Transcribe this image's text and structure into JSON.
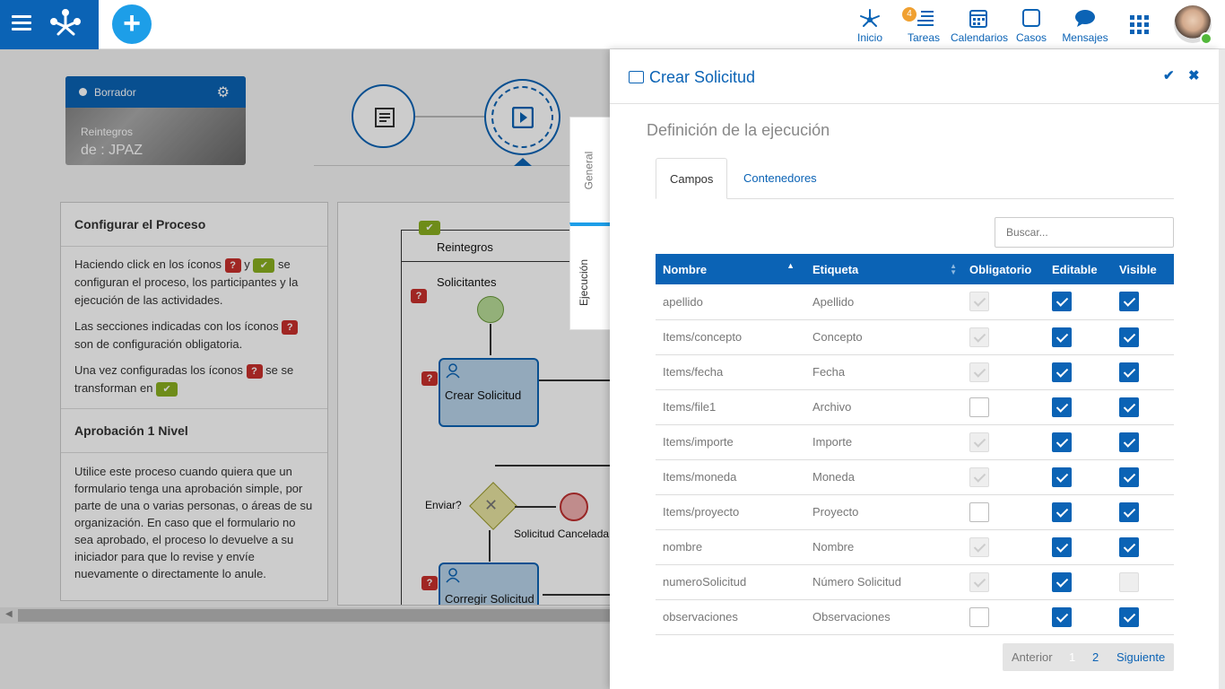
{
  "topbar": {
    "nav": [
      {
        "label": "Inicio",
        "icon": "network-icon"
      },
      {
        "label": "Tareas",
        "icon": "tasks-icon",
        "badge": "4"
      },
      {
        "label": "Calendarios",
        "icon": "calendar-icon"
      },
      {
        "label": "Casos",
        "icon": "square-icon"
      },
      {
        "label": "Mensajes",
        "icon": "chat-icon"
      }
    ]
  },
  "process_card": {
    "status": "Borrador",
    "title": "Reintegros",
    "owner": "de : JPAZ"
  },
  "left_panel": {
    "config_title": "Configurar el Proceso",
    "p1_a": "Haciendo click en los íconos",
    "p1_b": "y",
    "p1_c": "se configuran el proceso, los participantes y la ejecución de las actividades.",
    "p2_a": "Las secciones indicadas con los íconos",
    "p2_b": "son de configuración obligatoria.",
    "p3_a": "Una vez configuradas los íconos",
    "p3_b": "se transforman en",
    "approval_title": "Aprobación 1 Nivel",
    "approval_text": "Utilice este proceso cuando quiera que un formulario tenga una aprobación simple, por parte de una o varias personas, o áreas de su organización. En caso que el formulario no sea aprobado, el proceso lo devuelve a su iniciador para que lo revise y envíe nuevamente o directamente lo anule."
  },
  "diagram": {
    "pool": "Reintegros",
    "lane": "Solicitantes",
    "task1": "Crear Solicitud",
    "task2": "Corregir Solicitud",
    "gateway": "Enviar?",
    "end": "Solicitud Cancelada"
  },
  "vtabs": {
    "general": "General",
    "ejecucion": "Ejecución"
  },
  "side": {
    "title": "Crear Solicitud",
    "section": "Definición de la ejecución",
    "tabs": [
      "Campos",
      "Contenedores"
    ],
    "search_placeholder": "Buscar...",
    "columns": [
      "Nombre",
      "Etiqueta",
      "Obligatorio",
      "Editable",
      "Visible"
    ],
    "rows": [
      {
        "nombre": "apellido",
        "etiqueta": "Apellido",
        "obligatorio": "disabled-checked",
        "editable": true,
        "visible": true
      },
      {
        "nombre": "Items/concepto",
        "etiqueta": "Concepto",
        "obligatorio": "disabled-checked",
        "editable": true,
        "visible": true
      },
      {
        "nombre": "Items/fecha",
        "etiqueta": "Fecha",
        "obligatorio": "disabled-checked",
        "editable": true,
        "visible": true
      },
      {
        "nombre": "Items/file1",
        "etiqueta": "Archivo",
        "obligatorio": "unchecked",
        "editable": true,
        "visible": true
      },
      {
        "nombre": "Items/importe",
        "etiqueta": "Importe",
        "obligatorio": "disabled-checked",
        "editable": true,
        "visible": true
      },
      {
        "nombre": "Items/moneda",
        "etiqueta": "Moneda",
        "obligatorio": "disabled-checked",
        "editable": true,
        "visible": true
      },
      {
        "nombre": "Items/proyecto",
        "etiqueta": "Proyecto",
        "obligatorio": "unchecked",
        "editable": true,
        "visible": true
      },
      {
        "nombre": "nombre",
        "etiqueta": "Nombre",
        "obligatorio": "disabled-checked",
        "editable": true,
        "visible": true
      },
      {
        "nombre": "numeroSolicitud",
        "etiqueta": "Número Solicitud",
        "obligatorio": "disabled-checked",
        "editable": true,
        "visible": "disabled"
      },
      {
        "nombre": "observaciones",
        "etiqueta": "Observaciones",
        "obligatorio": "unchecked",
        "editable": true,
        "visible": true
      }
    ],
    "pagination": {
      "prev": "Anterior",
      "pages": [
        "1",
        "2"
      ],
      "current": "1",
      "next": "Siguiente"
    }
  }
}
